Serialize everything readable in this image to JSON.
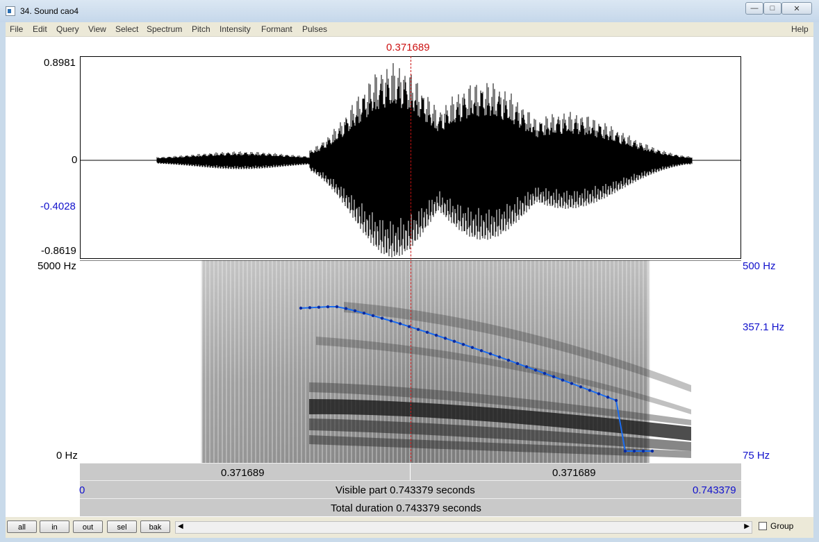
{
  "window": {
    "title": "34. Sound cao4"
  },
  "menu": {
    "items": [
      "File",
      "Edit",
      "Query",
      "View",
      "Select",
      "Spectrum",
      "Pitch",
      "Intensity",
      "Formant",
      "Pulses"
    ],
    "help": "Help"
  },
  "cursor": {
    "time_label": "0.371689"
  },
  "waveform": {
    "y_max": "0.8981",
    "y_zero": "0",
    "y_mark": "-0.4028",
    "y_min": "-0.8619"
  },
  "spectrogram": {
    "freq_max": "5000 Hz",
    "freq_min": "0 Hz",
    "pitch_max": "500 Hz",
    "pitch_mid": "357.1 Hz",
    "pitch_min": "75 Hz"
  },
  "timebars": {
    "left_segment": "0.371689",
    "right_segment": "0.371689",
    "visible_start": "0",
    "visible_part": "Visible part 0.743379 seconds",
    "visible_end": "0.743379",
    "total_duration": "Total duration 0.743379 seconds"
  },
  "buttons": {
    "all": "all",
    "in": "in",
    "out": "out",
    "sel": "sel",
    "bak": "bak"
  },
  "group": {
    "label": "Group",
    "checked": false
  },
  "colors": {
    "pitch": "#1a6cf0",
    "cursor": "#cc1111",
    "axis_blue": "#1111cc"
  }
}
